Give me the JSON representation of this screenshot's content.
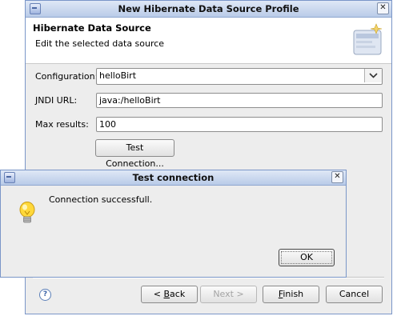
{
  "main_window": {
    "title": "New Hibernate Data Source Profile",
    "header_title": "Hibernate Data Source",
    "header_subtitle": "Edit the selected data source",
    "configuration_label": "Configuration:",
    "configuration_value": "helloBirt",
    "jndi_label": "JNDI URL:",
    "jndi_value": "java:/helloBirt",
    "max_results_label": "Max results:",
    "max_results_value": "100",
    "test_connection_label": "Test Connection...",
    "back_prefix": "< ",
    "back_mnemonic": "B",
    "back_rest": "ack",
    "next_label": "Next >",
    "finish_mnemonic": "F",
    "finish_rest": "inish",
    "cancel_label": "Cancel"
  },
  "dialog": {
    "title": "Test connection",
    "message": "Connection successfull.",
    "ok_label": "OK"
  },
  "icons": {
    "window": "window-icon",
    "close": "close-icon",
    "dropdown": "chevron-down-icon",
    "help": "help-icon",
    "info": "lightbulb-icon",
    "banner": "database-wizard-icon"
  }
}
